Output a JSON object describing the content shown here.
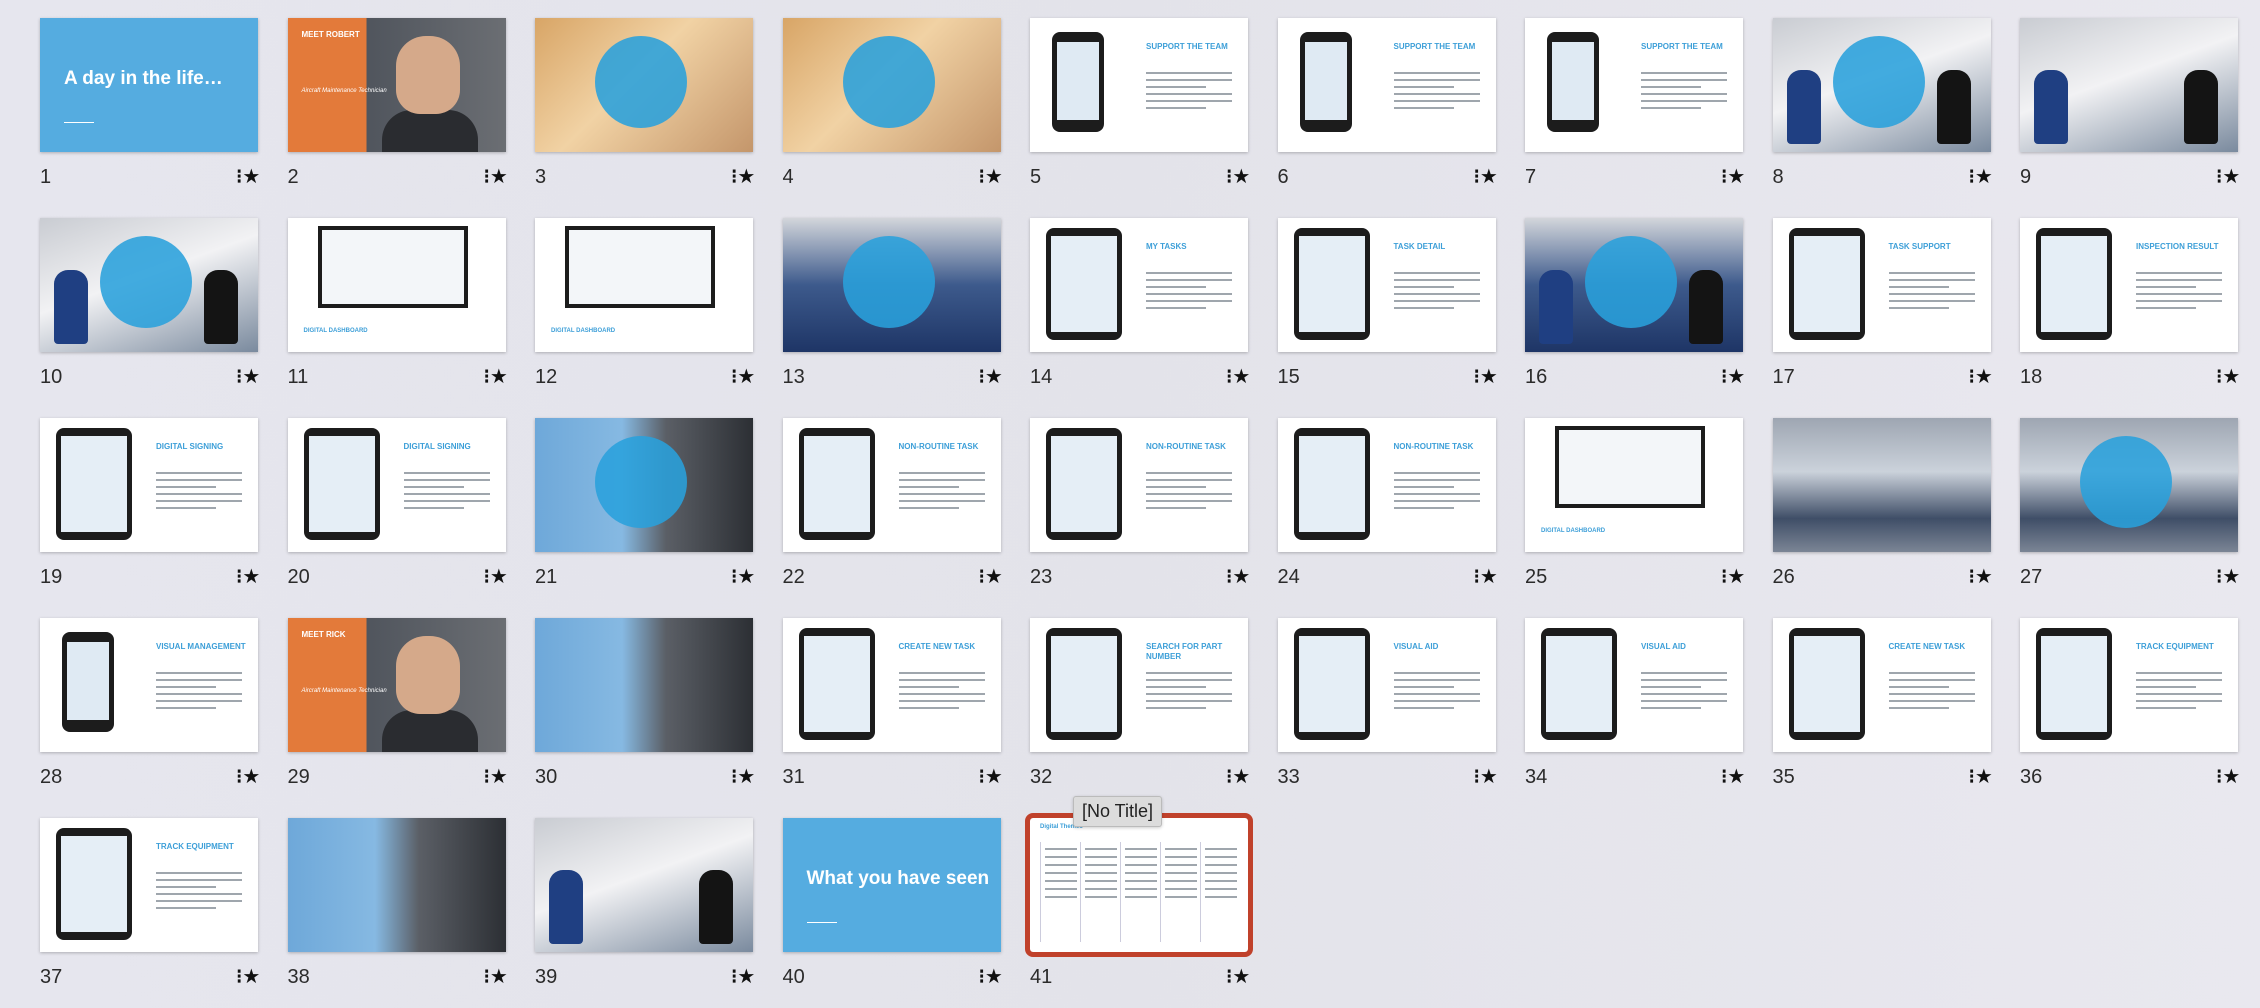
{
  "tooltip": "[No Title]",
  "slides": [
    {
      "num": "1",
      "kind": "blue",
      "title": "A day in the life…"
    },
    {
      "num": "2",
      "kind": "meet",
      "tag": "MEET ROBERT",
      "role": "Aircraft Maintenance Technician"
    },
    {
      "num": "3",
      "kind": "photo",
      "variant": "warm"
    },
    {
      "num": "4",
      "kind": "photo",
      "variant": "warm"
    },
    {
      "num": "5",
      "kind": "white",
      "device": "phone",
      "head": "SUPPORT THE TEAM"
    },
    {
      "num": "6",
      "kind": "white",
      "device": "phone",
      "head": "SUPPORT THE TEAM"
    },
    {
      "num": "7",
      "kind": "white",
      "device": "phone",
      "head": "SUPPORT THE TEAM"
    },
    {
      "num": "8",
      "kind": "photo",
      "variant": "hall",
      "people": true
    },
    {
      "num": "9",
      "kind": "photo",
      "variant": "hall",
      "people": true,
      "nocircle": true
    },
    {
      "num": "10",
      "kind": "photo",
      "variant": "hall",
      "people": true
    },
    {
      "num": "11",
      "kind": "white",
      "device": "monitor",
      "foot": "DIGITAL DASHBOARD"
    },
    {
      "num": "12",
      "kind": "white",
      "device": "monitor",
      "foot": "DIGITAL DASHBOARD"
    },
    {
      "num": "13",
      "kind": "photo",
      "variant": "seats"
    },
    {
      "num": "14",
      "kind": "white",
      "device": "tablet",
      "head": "MY TASKS"
    },
    {
      "num": "15",
      "kind": "white",
      "device": "tablet",
      "head": "TASK DETAIL"
    },
    {
      "num": "16",
      "kind": "photo",
      "variant": "seats",
      "people": true
    },
    {
      "num": "17",
      "kind": "white",
      "device": "tablet",
      "head": "TASK SUPPORT"
    },
    {
      "num": "18",
      "kind": "white",
      "device": "tablet",
      "head": "INSPECTION RESULT"
    },
    {
      "num": "19",
      "kind": "white",
      "device": "tablet",
      "head": "DIGITAL SIGNING"
    },
    {
      "num": "20",
      "kind": "white",
      "device": "tablet",
      "head": "DIGITAL SIGNING"
    },
    {
      "num": "21",
      "kind": "photo",
      "variant": "engine"
    },
    {
      "num": "22",
      "kind": "white",
      "device": "tablet",
      "head": "NON-ROUTINE TASK"
    },
    {
      "num": "23",
      "kind": "white",
      "device": "tablet",
      "head": "NON-ROUTINE TASK"
    },
    {
      "num": "24",
      "kind": "white",
      "device": "tablet",
      "head": "NON-ROUTINE TASK"
    },
    {
      "num": "25",
      "kind": "white",
      "device": "monitor",
      "foot": "DIGITAL DASHBOARD"
    },
    {
      "num": "26",
      "kind": "photo",
      "variant": "plane",
      "nocircle": true
    },
    {
      "num": "27",
      "kind": "photo",
      "variant": "plane"
    },
    {
      "num": "28",
      "kind": "white",
      "device": "phone",
      "head": "VISUAL MANAGEMENT"
    },
    {
      "num": "29",
      "kind": "meet",
      "tag": "MEET RICK",
      "role": "Aircraft Maintenance Technician"
    },
    {
      "num": "30",
      "kind": "photo",
      "variant": "engine",
      "nocircle": true
    },
    {
      "num": "31",
      "kind": "white",
      "device": "tablet",
      "head": "CREATE NEW TASK"
    },
    {
      "num": "32",
      "kind": "white",
      "device": "tablet",
      "head": "SEARCH FOR PART NUMBER"
    },
    {
      "num": "33",
      "kind": "white",
      "device": "tablet",
      "head": "VISUAL AID"
    },
    {
      "num": "34",
      "kind": "white",
      "device": "tablet",
      "head": "VISUAL AID"
    },
    {
      "num": "35",
      "kind": "white",
      "device": "tablet",
      "head": "CREATE NEW TASK"
    },
    {
      "num": "36",
      "kind": "white",
      "device": "tablet",
      "head": "TRACK EQUIPMENT"
    },
    {
      "num": "37",
      "kind": "white",
      "device": "tablet",
      "head": "TRACK EQUIPMENT"
    },
    {
      "num": "38",
      "kind": "photo",
      "variant": "engine",
      "nocircle": true
    },
    {
      "num": "39",
      "kind": "photo",
      "variant": "hall",
      "people": true,
      "nocircle": true
    },
    {
      "num": "40",
      "kind": "blue",
      "title": "What you have seen"
    },
    {
      "num": "41",
      "kind": "table",
      "title": "Digital Themes",
      "selected": true
    }
  ]
}
